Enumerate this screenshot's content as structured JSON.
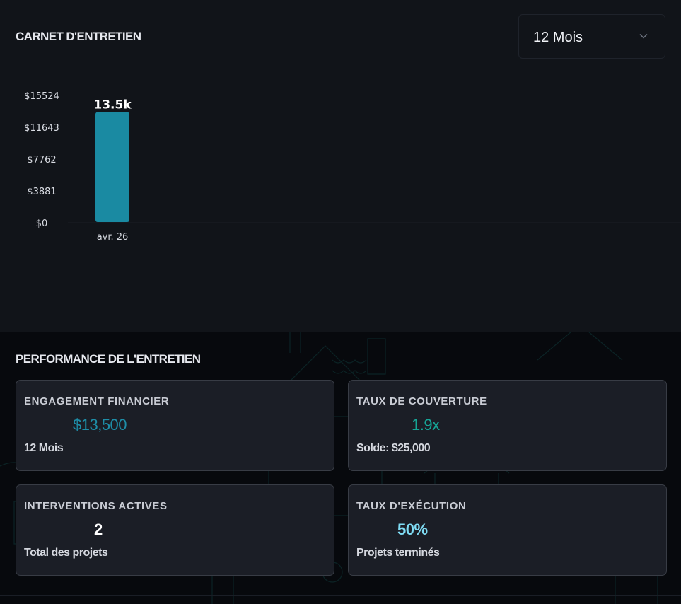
{
  "header": {
    "title": "CARNET D'ENTRETIEN",
    "range_select_value": "12 Mois"
  },
  "chart_data": {
    "type": "bar",
    "categories": [
      "avr. 26"
    ],
    "values": [
      13500
    ],
    "data_labels": [
      "13.5k"
    ],
    "yticks": [
      "$0",
      "$3881",
      "$7762",
      "$11643",
      "$15524"
    ],
    "ylim": [
      0,
      15524
    ],
    "grid": false,
    "bar_color": "#1a8aa2"
  },
  "performance": {
    "title": "PERFORMANCE DE L'ENTRETIEN",
    "cards": [
      {
        "label": "ENGAGEMENT FINANCIER",
        "value": "$13,500",
        "sub": "12 Mois",
        "color": "#1e8ea8"
      },
      {
        "label": "TAUX DE COUVERTURE",
        "value": "1.9x",
        "sub": "Solde: $25,000",
        "color": "#16a596"
      },
      {
        "label": "INTERVENTIONS ACTIVES",
        "value": "2",
        "sub": "Total des projets",
        "color": "#ffffff"
      },
      {
        "label": "TAUX D'EXÉCUTION",
        "value": "50%",
        "sub": "Projets terminés",
        "color": "#7fdcf4"
      }
    ]
  },
  "icons": {
    "dropdown": "chevron-down-icon"
  }
}
